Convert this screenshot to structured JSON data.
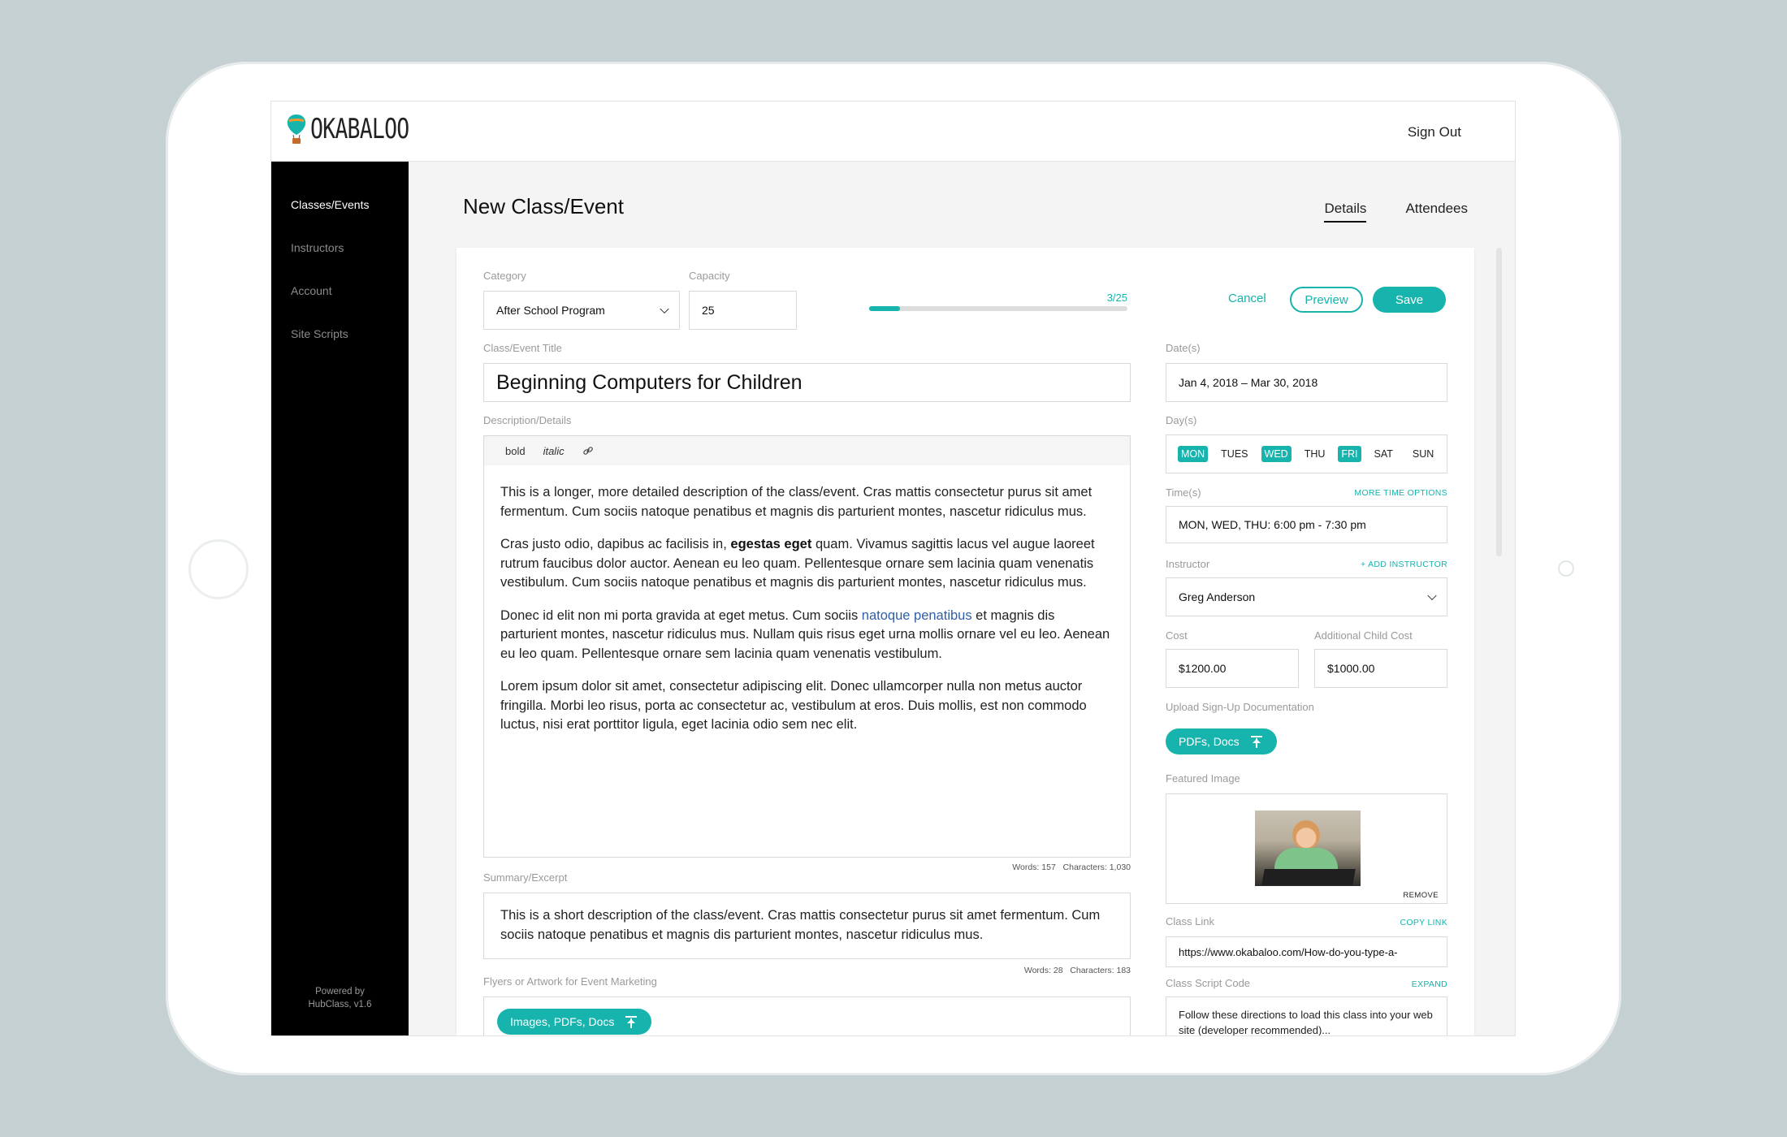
{
  "app": {
    "logo_text": "OKABALOO",
    "sign_out": "Sign Out"
  },
  "sidebar": {
    "items": [
      {
        "label": "Classes/Events",
        "active": true
      },
      {
        "label": "Instructors",
        "active": false
      },
      {
        "label": "Account",
        "active": false
      },
      {
        "label": "Site Scripts",
        "active": false
      }
    ],
    "powered_line1": "Powered by",
    "powered_line2": "HubClass, v1.6"
  },
  "header": {
    "title": "New Class/Event",
    "tabs": [
      {
        "label": "Details",
        "active": true
      },
      {
        "label": "Attendees",
        "active": false
      }
    ]
  },
  "form": {
    "category": {
      "label": "Category",
      "value": "After School Program"
    },
    "capacity": {
      "label": "Capacity",
      "value": "25",
      "filled_text": "3/25",
      "filled_fraction": 0.12
    },
    "actions": {
      "cancel": "Cancel",
      "preview": "Preview",
      "save": "Save"
    },
    "title": {
      "label": "Class/Event Title",
      "value": "Beginning Computers for Children"
    },
    "description": {
      "label": "Description/Details",
      "toolbar": {
        "bold": "bold",
        "italic": "italic"
      },
      "p1": "This is a longer, more detailed description of the class/event. Cras mattis consectetur purus sit amet fermentum. Cum sociis natoque penatibus et magnis dis parturient montes, nascetur ridiculus mus.",
      "p2_before": "Cras justo odio, dapibus ac facilisis in, ",
      "p2_bold": "egestas eget",
      "p2_after": " quam. Vivamus sagittis lacus vel augue laoreet rutrum faucibus dolor auctor. Aenean eu leo quam. Pellentesque ornare sem lacinia quam venenatis vestibulum. Cum sociis natoque penatibus et magnis dis parturient montes, nascetur ridiculus mus.",
      "p3_before": "Donec id elit non mi porta gravida at eget metus. Cum sociis ",
      "p3_link": "natoque penatibus",
      "p3_after": " et magnis dis parturient montes, nascetur ridiculus mus. Nullam quis risus eget urna mollis ornare vel eu leo. Aenean eu leo quam. Pellentesque ornare sem lacinia quam venenatis vestibulum.",
      "p4": "Lorem ipsum dolor sit amet, consectetur adipiscing elit. Donec ullamcorper nulla non metus auctor fringilla. Morbi leo risus, porta ac consectetur ac, vestibulum at eros. Duis mollis, est non commodo luctus, nisi erat porttitor ligula, eget lacinia odio sem nec elit.",
      "counts": "Words: 157   Characters: 1,030"
    },
    "summary": {
      "label": "Summary/Excerpt",
      "value": "This is a short description of the class/event. Cras mattis consectetur purus sit amet fermentum. Cum sociis natoque penatibus et magnis dis parturient montes, nascetur ridiculus mus.",
      "counts": "Words: 28   Characters: 183"
    },
    "flyers": {
      "label": "Flyers or Artwork for Event Marketing",
      "button": "Images, PDFs, Docs"
    },
    "dates": {
      "label": "Date(s)",
      "value": "Jan 4, 2018 – Mar 30, 2018"
    },
    "days": {
      "label": "Day(s)",
      "items": [
        {
          "label": "MON",
          "on": true
        },
        {
          "label": "TUES",
          "on": false
        },
        {
          "label": "WED",
          "on": true
        },
        {
          "label": "THU",
          "on": false
        },
        {
          "label": "FRI",
          "on": true
        },
        {
          "label": "SAT",
          "on": false
        },
        {
          "label": "SUN",
          "on": false
        }
      ]
    },
    "times": {
      "label": "Time(s)",
      "link": "MORE TIME OPTIONS",
      "value": "MON, WED, THU:  6:00 pm - 7:30 pm"
    },
    "instructor": {
      "label": "Instructor",
      "link": "+ ADD INSTRUCTOR",
      "value": "Greg Anderson"
    },
    "cost": {
      "label": "Cost",
      "value": "$1200.00"
    },
    "additional_cost": {
      "label": "Additional Child Cost",
      "value": "$1000.00"
    },
    "upload_docs": {
      "label": "Upload Sign-Up Documentation",
      "button": "PDFs, Docs"
    },
    "featured_image": {
      "label": "Featured Image",
      "remove": "REMOVE"
    },
    "class_link": {
      "label": "Class Link",
      "link": "COPY LINK",
      "value": "https://www.okabaloo.com/How-do-you-type-a-"
    },
    "script_code": {
      "label": "Class Script Code",
      "link": "EXPAND",
      "value": "Follow these directions to load this class into your web site (developer recommended)..."
    }
  },
  "colors": {
    "accent": "#17b3ad",
    "sidebar": "#000000",
    "link": "#2f5ea8"
  }
}
